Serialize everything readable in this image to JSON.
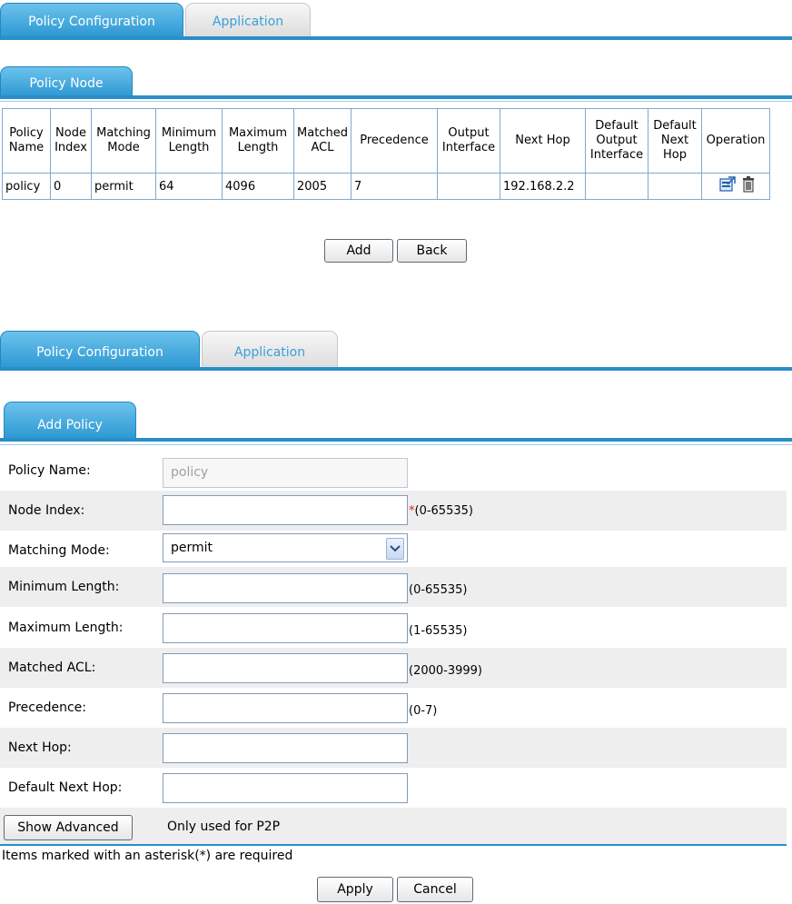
{
  "top_tabs": {
    "active": "Policy Configuration",
    "inactive": "Application"
  },
  "policy_node": {
    "tab": "Policy Node",
    "headers": [
      [
        "Policy",
        "Name"
      ],
      [
        "Node",
        "Index"
      ],
      [
        "Matching",
        "Mode"
      ],
      [
        "Minimum",
        "Length"
      ],
      [
        "Maximum",
        "Length"
      ],
      [
        "Matched",
        "ACL"
      ],
      [
        "Precedence"
      ],
      [
        "Output",
        "Interface"
      ],
      [
        "Next Hop"
      ],
      [
        "Default",
        "Output",
        "Interface"
      ],
      [
        "Default",
        "Next",
        "Hop"
      ],
      [
        "Operation"
      ]
    ],
    "row": {
      "policy_name": "policy",
      "node_index": "0",
      "matching_mode": "permit",
      "minimum_length": "64",
      "maximum_length": "4096",
      "matched_acl": "2005",
      "precedence": "7",
      "output_interface": "",
      "next_hop": "192.168.2.2",
      "default_output_interface": "",
      "default_next_hop": "",
      "operation_icons": [
        "edit-icon",
        "delete-icon"
      ]
    },
    "add_label": "Add",
    "back_label": "Back"
  },
  "second_tabs": {
    "active": "Policy Configuration",
    "inactive": "Application"
  },
  "add_policy": {
    "tab": "Add Policy",
    "policy_name_label": "Policy Name:",
    "policy_name_value": "policy",
    "node_index_label": "Node Index:",
    "node_index_hint": "(0-65535)",
    "matching_mode_label": "Matching Mode:",
    "matching_mode_value": "permit",
    "minimum_length_label": "Minimum Length:",
    "minimum_length_hint": "(0-65535)",
    "maximum_length_label": "Maximum Length:",
    "maximum_length_hint": "(1-65535)",
    "matched_acl_label": "Matched ACL:",
    "matched_acl_hint": "(2000-3999)",
    "precedence_label": "Precedence:",
    "precedence_hint": "(0-7)",
    "next_hop_label": "Next Hop:",
    "default_next_hop_label": "Default Next Hop:",
    "show_advanced_label": "Show Advanced",
    "only_p2p_text": "Only used for P2P",
    "required_note": "Items marked with an asterisk(*) are required",
    "apply_label": "Apply",
    "cancel_label": "Cancel",
    "asterisk": "*"
  },
  "colors": {
    "accent": "#2a8ec8",
    "tab_text_inactive": "#3a9fd8",
    "required": "#e02020",
    "row_alt": "#eeeeee"
  }
}
